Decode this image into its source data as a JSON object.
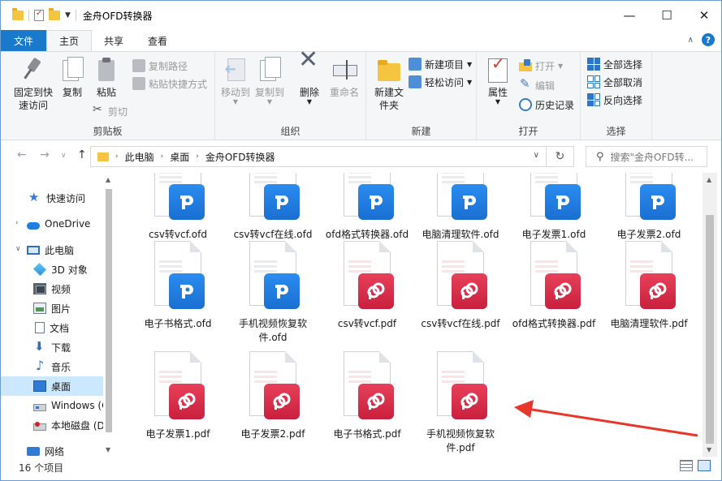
{
  "window": {
    "title": "金舟OFD转换器",
    "controls": {
      "minimize": "—",
      "maximize": "☐",
      "close": "✕"
    }
  },
  "tabs": [
    {
      "label": "文件"
    },
    {
      "label": "主页"
    },
    {
      "label": "共享"
    },
    {
      "label": "查看"
    }
  ],
  "help_label": "?",
  "ribbon": {
    "clipboard": {
      "label": "剪贴板",
      "pin_label": "固定到快速访问",
      "copy_label": "复制",
      "paste_label": "粘贴",
      "copy_path": "复制路径",
      "paste_shortcut": "粘贴快捷方式",
      "cut": "剪切"
    },
    "organize": {
      "label": "组织",
      "move_to": "移动到",
      "copy_to": "复制到",
      "delete": "删除",
      "rename": "重命名"
    },
    "new": {
      "label": "新建",
      "new_folder": "新建文件夹",
      "new_item": "新建项目",
      "easy_access": "轻松访问"
    },
    "open": {
      "label": "打开",
      "properties": "属性",
      "open": "打开",
      "edit": "编辑",
      "history": "历史记录"
    },
    "select": {
      "label": "选择",
      "select_all": "全部选择",
      "select_none": "全部取消",
      "invert": "反向选择"
    }
  },
  "address": {
    "crumbs": [
      "此电脑",
      "桌面",
      "金舟OFD转换器"
    ],
    "search_placeholder": "搜索\"金舟OFD转..."
  },
  "nav": {
    "items": [
      {
        "label": "快速访问",
        "icon": "star-icon"
      },
      {
        "label": "OneDrive",
        "icon": "cloud-icon"
      },
      {
        "label": "此电脑",
        "icon": "computer-icon"
      },
      {
        "label": "3D 对象",
        "icon": "cube-icon"
      },
      {
        "label": "视频",
        "icon": "video-icon"
      },
      {
        "label": "图片",
        "icon": "picture-icon"
      },
      {
        "label": "文档",
        "icon": "document-icon"
      },
      {
        "label": "下载",
        "icon": "download-icon"
      },
      {
        "label": "音乐",
        "icon": "music-icon"
      },
      {
        "label": "桌面",
        "icon": "desktop-icon",
        "selected": true
      },
      {
        "label": "Windows (C",
        "icon": "drive-icon"
      },
      {
        "label": "本地磁盘 (D",
        "icon": "disk-icon"
      },
      {
        "label": "网络",
        "icon": "network-icon"
      }
    ]
  },
  "files": [
    {
      "name": "csv转vcf.ofd",
      "type": "ofd"
    },
    {
      "name": "csv转vcf在线.ofd",
      "type": "ofd"
    },
    {
      "name": "ofd格式转换器.ofd",
      "type": "ofd"
    },
    {
      "name": "电脑清理软件.ofd",
      "type": "ofd"
    },
    {
      "name": "电子发票1.ofd",
      "type": "ofd"
    },
    {
      "name": "电子发票2.ofd",
      "type": "ofd"
    },
    {
      "name": "电子书格式.ofd",
      "type": "ofd"
    },
    {
      "name": "手机视频恢复软件.ofd",
      "type": "ofd"
    },
    {
      "name": "csv转vcf.pdf",
      "type": "pdf"
    },
    {
      "name": "csv转vcf在线.pdf",
      "type": "pdf"
    },
    {
      "name": "ofd格式转换器.pdf",
      "type": "pdf"
    },
    {
      "name": "电脑清理软件.pdf",
      "type": "pdf"
    },
    {
      "name": "电子发票1.pdf",
      "type": "pdf"
    },
    {
      "name": "电子发票2.pdf",
      "type": "pdf"
    },
    {
      "name": "电子书格式.pdf",
      "type": "pdf"
    },
    {
      "name": "手机视频恢复软件.pdf",
      "type": "pdf"
    }
  ],
  "status": {
    "count": "16 个项目"
  },
  "colors": {
    "ofd": "#1f7ee0",
    "pdf": "#d9304c",
    "accent": "#1979ca",
    "annotation": "#e8362b"
  }
}
